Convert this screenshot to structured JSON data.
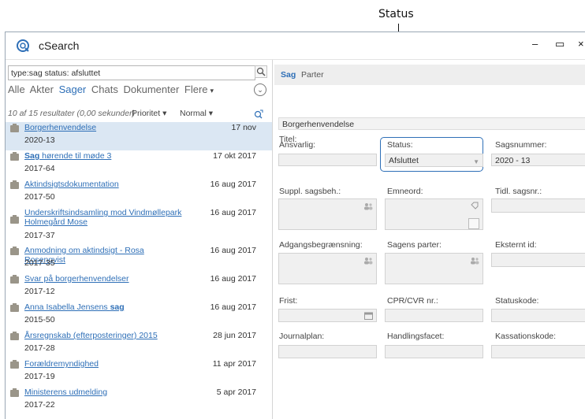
{
  "annotation": {
    "label": "Status"
  },
  "window": {
    "title": "cSearch",
    "controls": {
      "minimize": "–",
      "maximize": "▭",
      "close": "×"
    }
  },
  "search": {
    "value": "type:sag status: afsluttet",
    "placeholder": ""
  },
  "filters": {
    "items": [
      "Alle",
      "Akter",
      "Sager",
      "Chats",
      "Dokumenter",
      "Flere"
    ],
    "active": "Sager",
    "more_arrow": "▾"
  },
  "results": {
    "info": "10 af 15 resultater (0,00 sekunder)",
    "sort_priority": "Prioritet ▾",
    "sort_normal": "Normal ▾",
    "items": [
      {
        "title": "Borgerhenvendelse",
        "bold": "",
        "rest": "",
        "date": "17 nov",
        "number": "2020-13"
      },
      {
        "title": "",
        "bold": "Sag",
        "rest": " hørende til møde 3",
        "date": "17 okt 2017",
        "number": "2017-64"
      },
      {
        "title": "Aktindsigtsdokumentation",
        "bold": "",
        "rest": "",
        "date": "16 aug 2017",
        "number": "2017-50"
      },
      {
        "title": "Underskriftsindsamling mod Vindmøllepark Holmegård Mose",
        "bold": "",
        "rest": "",
        "date": "16 aug 2017",
        "number": "2017-37"
      },
      {
        "title": "Anmodning om aktindsigt - Rosa Rosenqvist",
        "bold": "",
        "rest": "",
        "date": "16 aug 2017",
        "number": "2017-35"
      },
      {
        "title": "Svar på borgerhenvendelser",
        "bold": "",
        "rest": "",
        "date": "16 aug 2017",
        "number": "2017-12"
      },
      {
        "title": "Anna Isabella Jensens ",
        "bold": "sag",
        "rest": "",
        "date": "16 aug 2017",
        "number": "2015-50"
      },
      {
        "title": "Årsregnskab (efterposteringer) 2015",
        "bold": "",
        "rest": "",
        "date": "28 jun 2017",
        "number": "2017-28"
      },
      {
        "title": "Forældremyndighed",
        "bold": "",
        "rest": "",
        "date": "11 apr 2017",
        "number": "2017-19"
      },
      {
        "title": "Ministerens udmelding",
        "bold": "",
        "rest": "",
        "date": "5 apr 2017",
        "number": "2017-22"
      }
    ]
  },
  "detail": {
    "tabs": [
      "Sag",
      "Parter"
    ],
    "active_tab": "Sag",
    "labels": {
      "titel": "Titel:",
      "ansvarlig": "Ansvarlig:",
      "status": "Status:",
      "sagsnummer": "Sagsnummer:",
      "suppl": "Suppl. sagsbeh.:",
      "emneord": "Emneord:",
      "tidl": "Tidl. sagsnr.:",
      "adgang": "Adgangsbegrænsning:",
      "parter": "Sagens parter:",
      "eksternt": "Eksternt id:",
      "frist": "Frist:",
      "cpr": "CPR/CVR nr.:",
      "statuskode": "Statuskode:",
      "journalplan": "Journalplan:",
      "handling": "Handlingsfacet:",
      "kassation": "Kassationskode:"
    },
    "values": {
      "titel": "Borgerhenvendelse",
      "status": "Afsluttet",
      "sagsnummer": "2020 - 13"
    }
  },
  "colors": {
    "accent": "#2e6fb7",
    "selected_row": "#dbe7f3"
  }
}
